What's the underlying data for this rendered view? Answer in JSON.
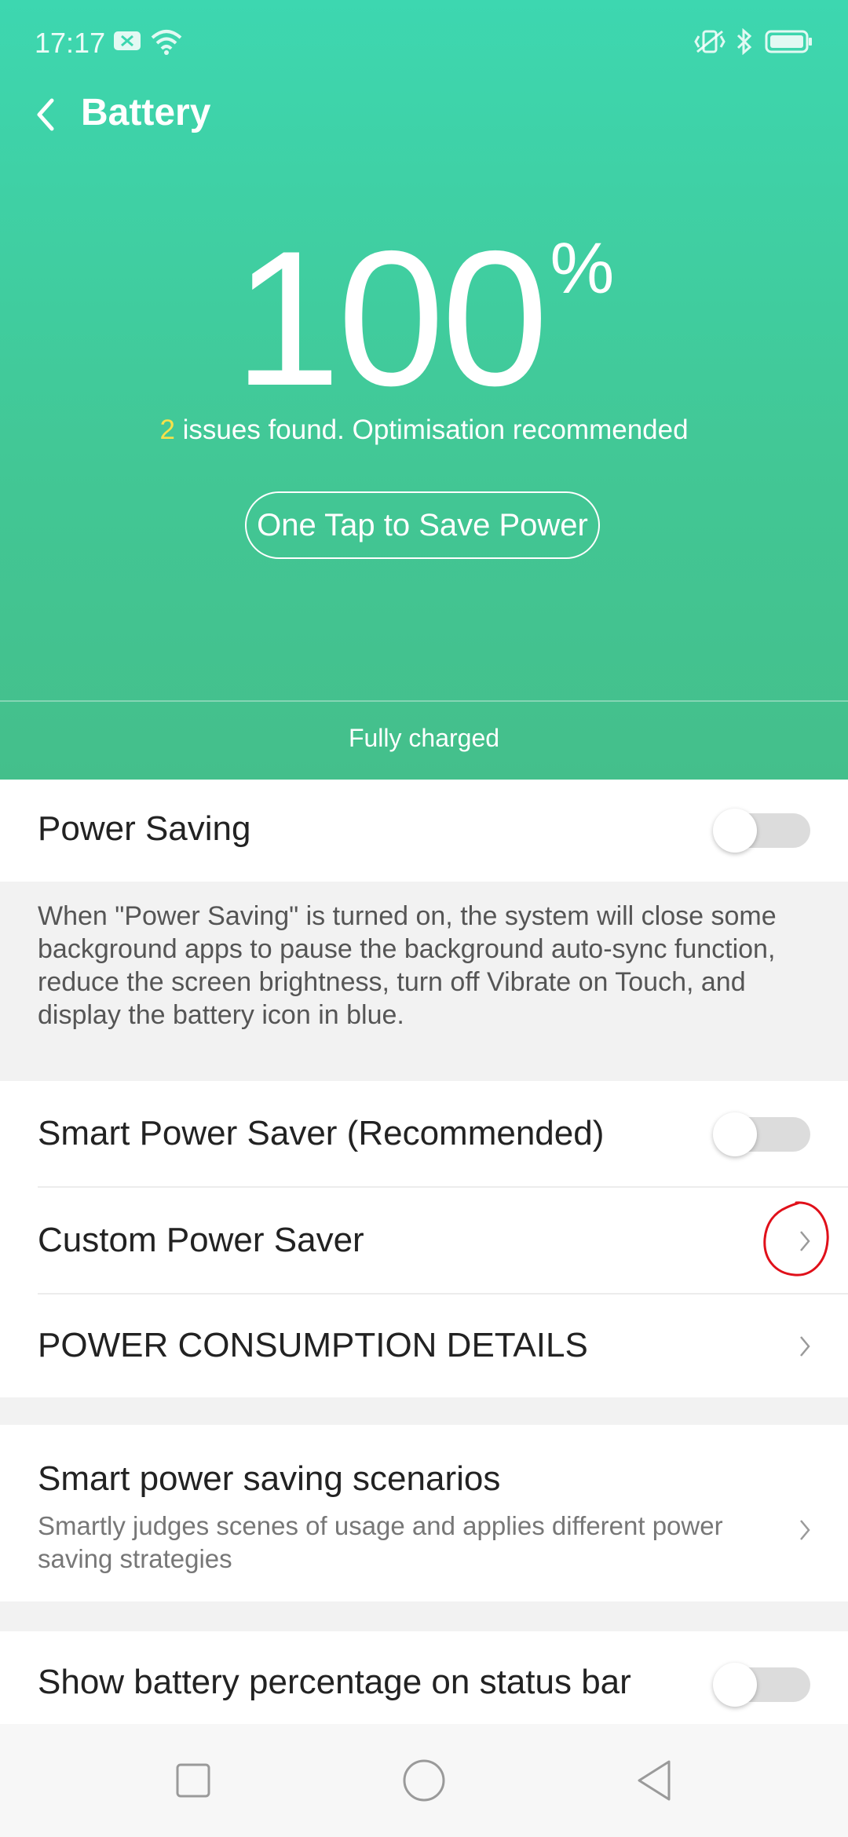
{
  "status_bar": {
    "time": "17:17",
    "icons": [
      "sim-x-icon",
      "wifi-icon",
      "vibrate-icon",
      "bluetooth-icon",
      "battery-icon"
    ]
  },
  "toolbar": {
    "title": "Battery",
    "back_icon": "back-chevron-icon"
  },
  "battery": {
    "percent": "100",
    "percent_sign": "%",
    "issues_count": "2",
    "issues_text": " issues found. Optimisation recommended",
    "save_button": "One Tap to Save Power",
    "charge_status": "Fully charged"
  },
  "settings": {
    "power_saving": {
      "label": "Power Saving",
      "enabled": false
    },
    "power_saving_desc": "When \"Power Saving\" is turned on, the system will close some background apps to pause the background auto-sync function, reduce the screen brightness, turn off Vibrate on Touch, and display the battery icon in blue.",
    "smart_power_saver": {
      "label": "Smart Power Saver (Recommended)",
      "enabled": false
    },
    "custom_power_saver": {
      "label": "Custom Power Saver"
    },
    "power_consumption": {
      "label": "POWER CONSUMPTION DETAILS"
    },
    "scenarios": {
      "label": "Smart power saving scenarios",
      "subtitle": "Smartly judges scenes of usage and applies different power saving strategies"
    },
    "show_percentage": {
      "label": "Show battery percentage on status bar",
      "enabled": false
    }
  },
  "nav": {
    "icons": [
      "recents-square-icon",
      "home-circle-icon",
      "back-triangle-icon"
    ]
  },
  "colors": {
    "header_top": "#3dd7b0",
    "header_bottom": "#44bf8b",
    "issues_accent": "#f7e14a",
    "annotation": "#e0101a"
  }
}
